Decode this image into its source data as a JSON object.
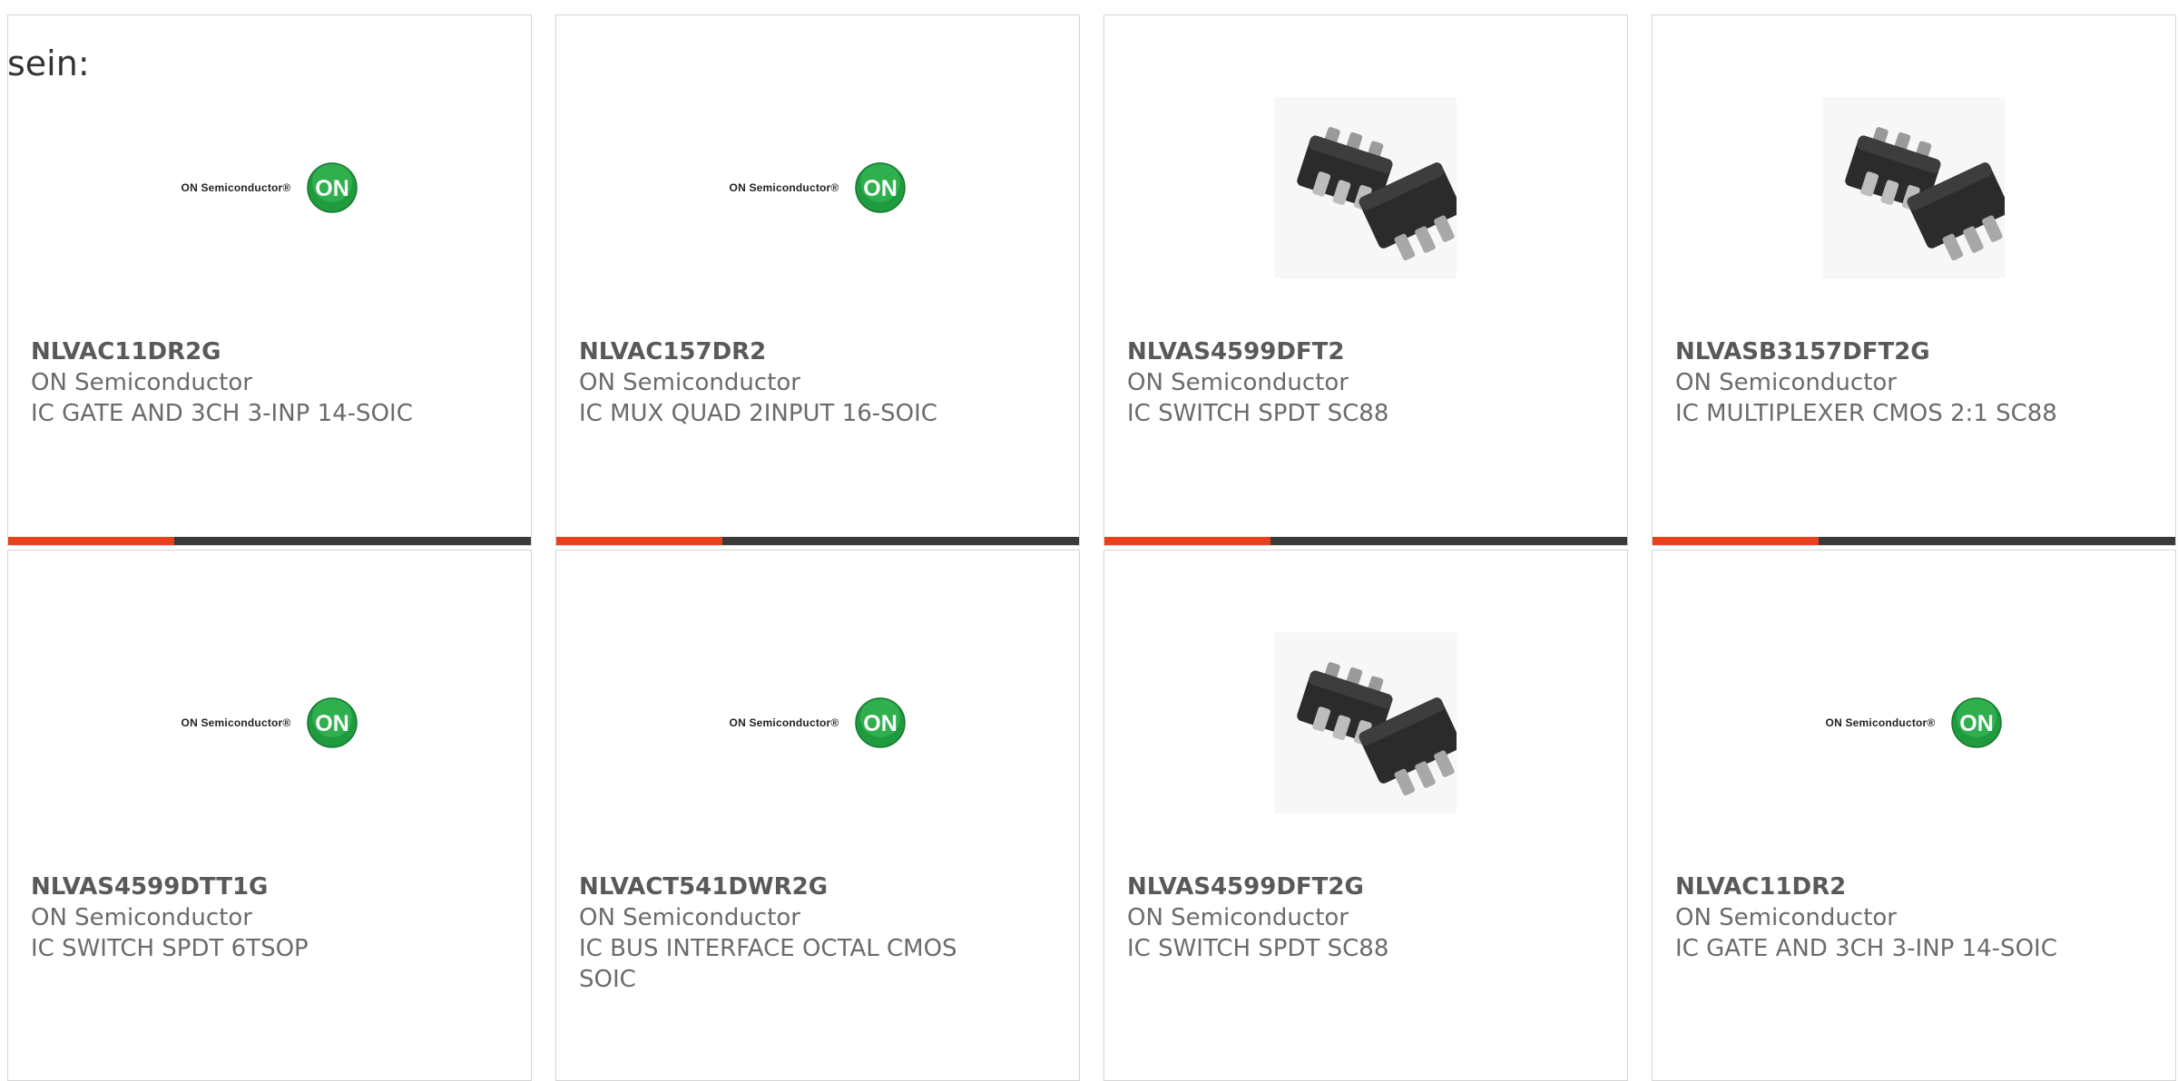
{
  "intro_text": "sein:",
  "logo_text": "ON Semiconductor®",
  "logo_badge": "ON",
  "colors": {
    "accent_bar": "#e8401c",
    "bar_dark": "#3a3a3a",
    "logo_green": "#1f9a3e",
    "card_border": "#d5d5d5"
  },
  "products": [
    {
      "part": "NLVAC11DR2G",
      "manufacturer": "ON Semiconductor",
      "description": "IC GATE AND 3CH 3-INP 14-SOIC",
      "image": "on-semiconductor-logo"
    },
    {
      "part": "NLVAC157DR2",
      "manufacturer": "ON Semiconductor",
      "description": "IC MUX QUAD 2INPUT 16-SOIC",
      "image": "on-semiconductor-logo"
    },
    {
      "part": "NLVAS4599DFT2",
      "manufacturer": "ON Semiconductor",
      "description": "IC SWITCH SPDT SC88",
      "image": "sc88-chip-photo"
    },
    {
      "part": "NLVASB3157DFT2G",
      "manufacturer": "ON Semiconductor",
      "description": "IC MULTIPLEXER CMOS 2:1 SC88",
      "image": "sc88-chip-photo"
    },
    {
      "part": "NLVAS4599DTT1G",
      "manufacturer": "ON Semiconductor",
      "description": "IC SWITCH SPDT 6TSOP",
      "image": "on-semiconductor-logo"
    },
    {
      "part": "NLVACT541DWR2G",
      "manufacturer": "ON Semiconductor",
      "description": "IC BUS INTERFACE OCTAL CMOS SOIC",
      "image": "on-semiconductor-logo"
    },
    {
      "part": "NLVAS4599DFT2G",
      "manufacturer": "ON Semiconductor",
      "description": "IC SWITCH SPDT SC88",
      "image": "sc88-chip-photo"
    },
    {
      "part": "NLVAC11DR2",
      "manufacturer": "ON Semiconductor",
      "description": "IC GATE AND 3CH 3-INP 14-SOIC",
      "image": "on-semiconductor-logo"
    }
  ]
}
